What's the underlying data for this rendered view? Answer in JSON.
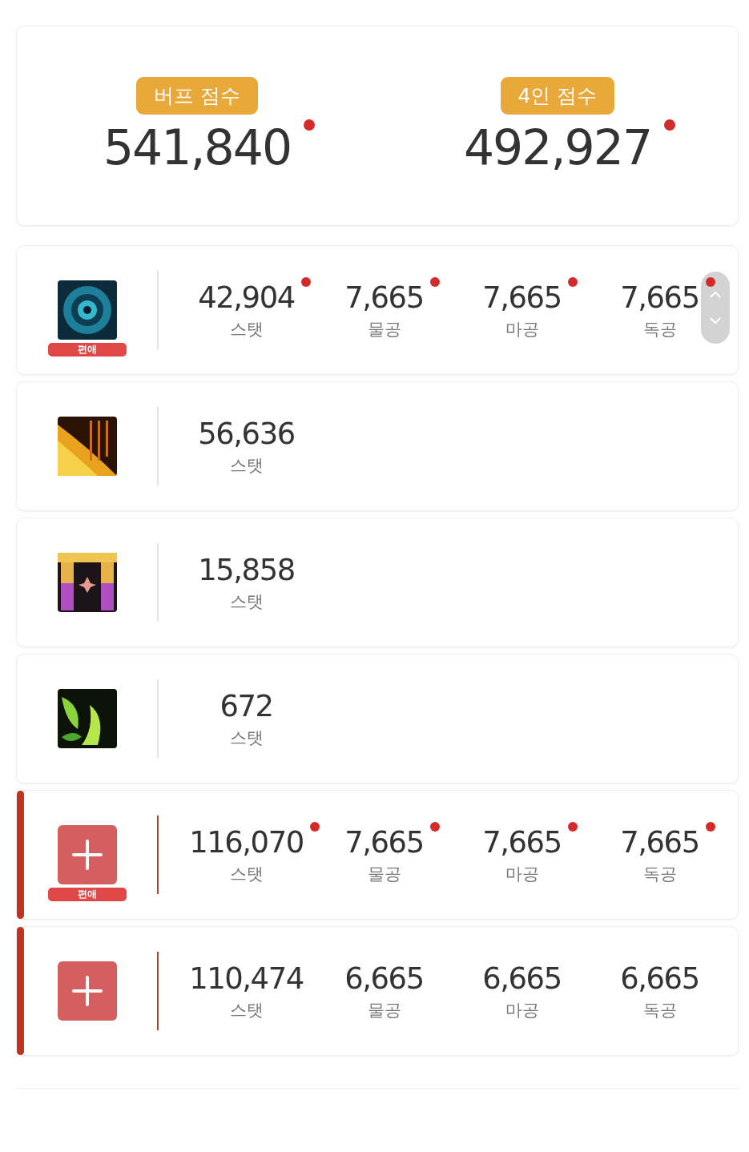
{
  "scores": [
    {
      "label": "버프 점수",
      "value": "541,840",
      "dot": true
    },
    {
      "label": "4인 점수",
      "value": "492,927",
      "dot": true
    }
  ],
  "rows": [
    {
      "kind": "skill",
      "badge": "편애",
      "stats": [
        {
          "value": "42,904",
          "label": "스탯",
          "dot": true
        },
        {
          "value": "7,665",
          "label": "물공",
          "dot": true
        },
        {
          "value": "7,665",
          "label": "마공",
          "dot": true
        },
        {
          "value": "7,665",
          "label": "독공",
          "dot": true
        }
      ]
    },
    {
      "kind": "skill",
      "stats": [
        {
          "value": "56,636",
          "label": "스탯",
          "dot": false
        }
      ]
    },
    {
      "kind": "skill",
      "stats": [
        {
          "value": "15,858",
          "label": "스탯",
          "dot": false
        }
      ]
    },
    {
      "kind": "skill",
      "stats": [
        {
          "value": "672",
          "label": "스탯",
          "dot": false
        }
      ]
    },
    {
      "kind": "add",
      "badge": "편애",
      "stats": [
        {
          "value": "116,070",
          "label": "스탯",
          "dot": true
        },
        {
          "value": "7,665",
          "label": "물공",
          "dot": true
        },
        {
          "value": "7,665",
          "label": "마공",
          "dot": true
        },
        {
          "value": "7,665",
          "label": "독공",
          "dot": true
        }
      ]
    },
    {
      "kind": "add",
      "stats": [
        {
          "value": "110,474",
          "label": "스탯",
          "dot": false
        },
        {
          "value": "6,665",
          "label": "물공",
          "dot": false
        },
        {
          "value": "6,665",
          "label": "마공",
          "dot": false
        },
        {
          "value": "6,665",
          "label": "독공",
          "dot": false
        }
      ]
    }
  ]
}
